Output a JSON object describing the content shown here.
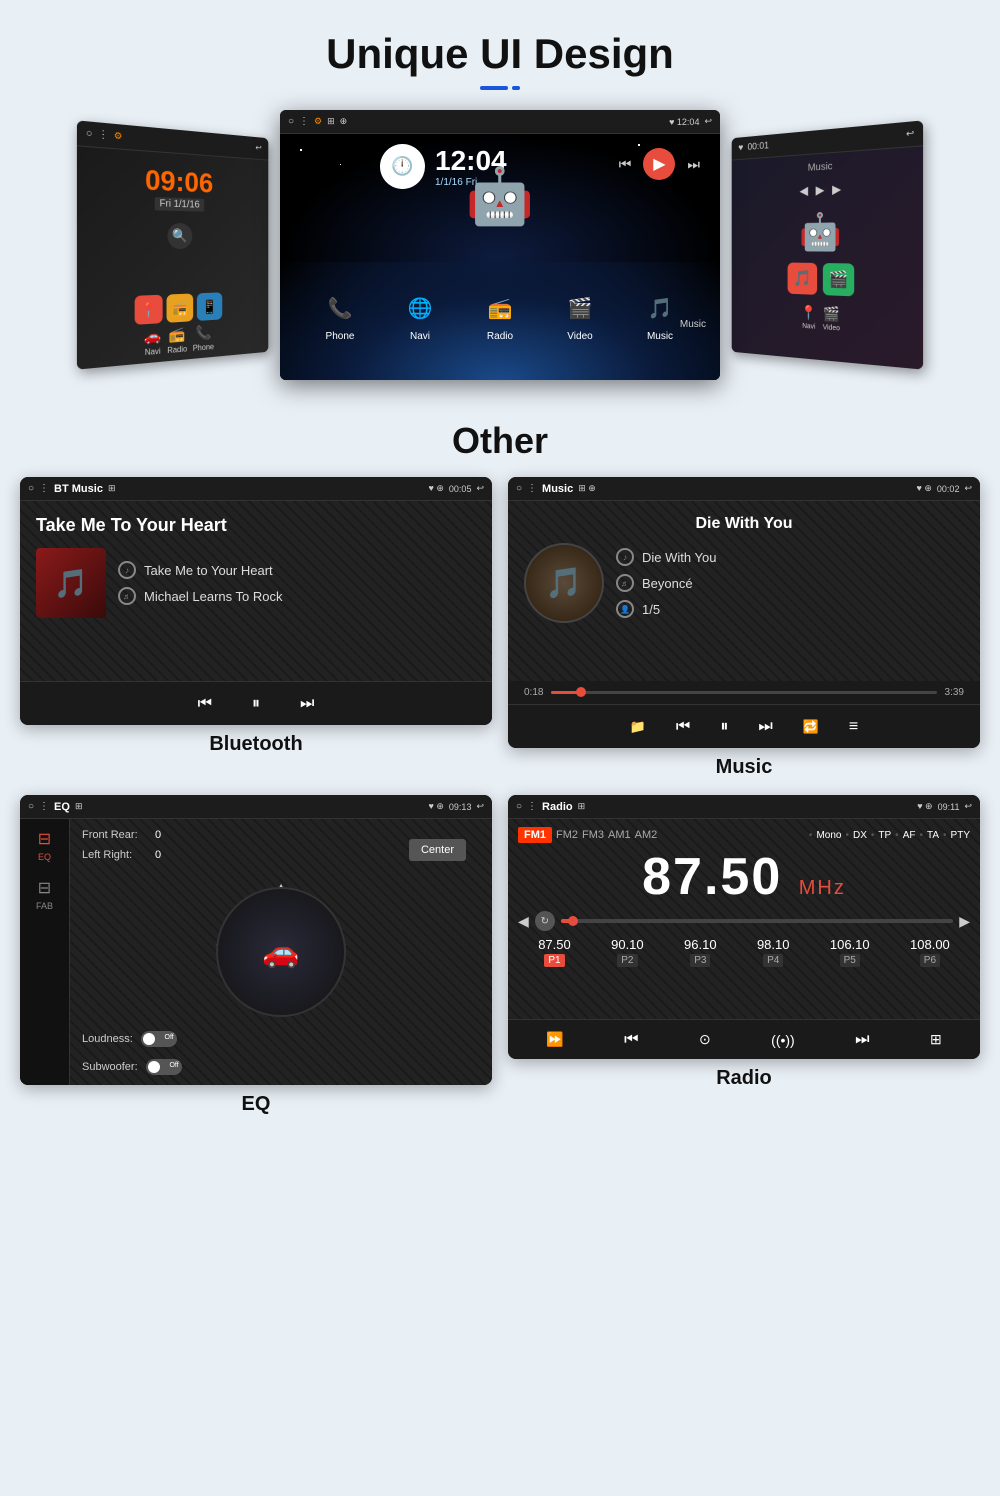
{
  "page": {
    "bg_color": "#e8eff5"
  },
  "header": {
    "title": "Unique UI Design",
    "underline_visible": true
  },
  "screens_section": {
    "left_screen": {
      "time": "09:06",
      "date": "Fri 1/1/16",
      "apps": [
        "📍",
        "📻",
        "📱"
      ],
      "nav_labels": [
        "Navi",
        "Radio",
        "Phone"
      ]
    },
    "center_screen": {
      "time": "12:04",
      "date": "1/1/16 Fri",
      "apps": [
        "Phone",
        "Navi",
        "Radio",
        "Video",
        "Music"
      ]
    },
    "right_screen": {
      "label": "Music"
    }
  },
  "other_section": {
    "title": "Other"
  },
  "bluetooth_panel": {
    "label": "Bluetooth",
    "topbar_left": [
      "○",
      "⋮",
      "BT Music",
      "⊞"
    ],
    "topbar_right": [
      "♥",
      "⊕",
      "00:05",
      "↩"
    ],
    "title": "Take Me To Your Heart",
    "track_name": "Take Me to Your Heart",
    "artist": "Michael Learns To Rock",
    "controls": [
      "⏮",
      "⏸",
      "⏭"
    ]
  },
  "music_panel": {
    "label": "Music",
    "topbar_left": [
      "○",
      "⋮",
      "Music",
      "⊞",
      "⊕"
    ],
    "topbar_right": [
      "♥",
      "⊕",
      "00:02",
      "↩"
    ],
    "title": "Die With You",
    "track_name": "Die With You",
    "artist": "Beyoncé",
    "track_num": "1/5",
    "time_current": "0:18",
    "time_total": "3:39",
    "controls": [
      "📁",
      "⏮",
      "⏸",
      "⏭",
      "🔁",
      "≡"
    ]
  },
  "eq_panel": {
    "label": "EQ",
    "topbar_left": [
      "○",
      "⋮",
      "EQ",
      "⊞"
    ],
    "topbar_right": [
      "♥",
      "⊕",
      "09:13",
      "↩"
    ],
    "sidebar_items": [
      {
        "icon": "≡",
        "label": "EQ",
        "active": true
      },
      {
        "icon": "≡",
        "label": "FAB",
        "active": false
      }
    ],
    "front_rear": "0",
    "left_right": "0",
    "loudness": "Off",
    "subwoofer": "Off",
    "center_btn": "Center"
  },
  "radio_panel": {
    "label": "Radio",
    "topbar_left": [
      "○",
      "⋮",
      "Radio",
      "⊞"
    ],
    "topbar_right": [
      "♥",
      "⊕",
      "09:11",
      "↩"
    ],
    "bands": [
      "FM1",
      "FM2",
      "FM3",
      "AM1",
      "AM2"
    ],
    "active_band": "FM1",
    "options": [
      "Mono",
      "DX",
      "TP",
      "AF",
      "TA",
      "PTY"
    ],
    "frequency": "87.50",
    "unit": "MHz",
    "presets": [
      {
        "freq": "87.50",
        "num": "P1",
        "active": true
      },
      {
        "freq": "90.10",
        "num": "P2",
        "active": false
      },
      {
        "freq": "96.10",
        "num": "P3",
        "active": false
      },
      {
        "freq": "98.10",
        "num": "P4",
        "active": false
      },
      {
        "freq": "106.10",
        "num": "P5",
        "active": false
      },
      {
        "freq": "108.00",
        "num": "P6",
        "active": false
      }
    ]
  }
}
